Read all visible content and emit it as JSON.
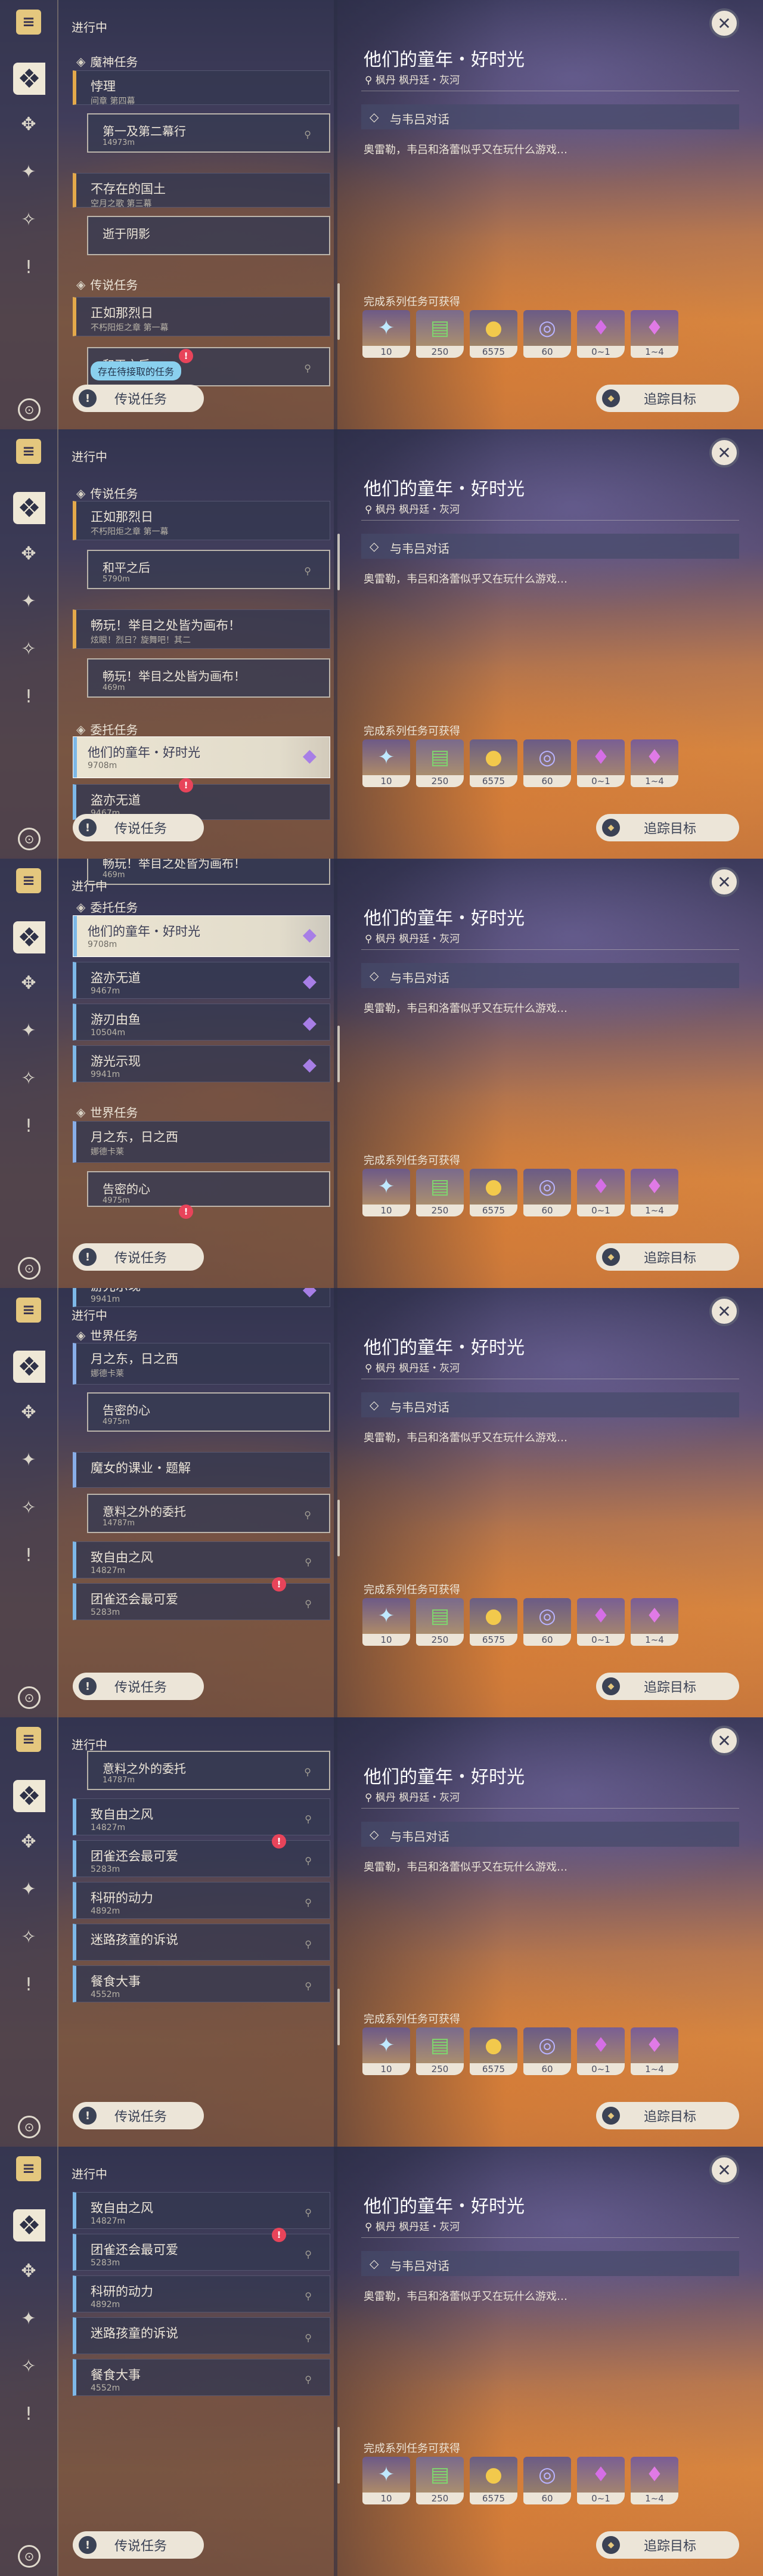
{
  "ui": {
    "in_progress": "进行中",
    "bottom_button": "传说任务",
    "tooltip": "存在待接取的任务",
    "track_button": "追踪目标"
  },
  "detail": {
    "title": "他们的童年・好时光",
    "location": "枫丹 枫丹廷・灰河",
    "step": "与韦吕对话",
    "description": "奥雷勒，韦吕和洛蕾似乎又在玩什么游戏…",
    "rewards_header": "完成系列任务可获得",
    "rewards": [
      {
        "icon": "primogem-icon",
        "count": "10"
      },
      {
        "icon": "hero-wit-icon",
        "count": "250"
      },
      {
        "icon": "mora-icon",
        "count": "6575"
      },
      {
        "icon": "adventure-exp-icon",
        "count": "60"
      },
      {
        "icon": "crystal-icon",
        "count": "0~1"
      },
      {
        "icon": "crystal-cluster-icon",
        "count": "1~4"
      }
    ]
  },
  "rail": {
    "top_icon": "quest-book-icon",
    "items": [
      "all-quests-icon",
      "archon-quest-icon",
      "world-quest-icon",
      "commission-icon",
      "event-icon"
    ],
    "bottom_icon": "navigation-icon"
  },
  "categories": {
    "archon": "魔神任务",
    "legend": "传说任务",
    "commission": "委托任务",
    "world": "世界任务"
  },
  "quests": {
    "q_dinglie": {
      "title": "悖理",
      "sub": "间章 第四幕"
    },
    "q_first_act": {
      "title": "第一及第二幕行",
      "sub": "14973m"
    },
    "q_nonexist": {
      "title": "不存在的国土",
      "sub": "空月之歌 第三幕"
    },
    "q_shadow": {
      "title": "逝于阴影",
      "sub": ""
    },
    "q_zhengru": {
      "title": "正如那烈日",
      "sub": "不朽阳炬之章 第一幕"
    },
    "q_peace": {
      "title": "和平之后",
      "sub": "5790m"
    },
    "q_play": {
      "title": "畅玩！举目之处皆为画布！",
      "sub": "炫眼！烈日？旋舞吧！其二"
    },
    "q_play_sub": {
      "title": "畅玩！举目之处皆为画布！",
      "sub": "469m"
    },
    "q_childhood": {
      "title": "他们的童年・好时光",
      "sub": "9708m"
    },
    "q_guidao": {
      "title": "盗亦无道",
      "sub": "9467m"
    },
    "q_youren": {
      "title": "游刃由鱼",
      "sub": "10504m"
    },
    "q_youguang": {
      "title": "游光示现",
      "sub": "9941m"
    },
    "q_moon": {
      "title": "月之东，日之西",
      "sub": "娜德卡莱"
    },
    "q_confess": {
      "title": "告密的心",
      "sub": "4975m"
    },
    "q_witch": {
      "title": "魔女的课业・题解",
      "sub": ""
    },
    "q_unexpected": {
      "title": "意料之外的委托",
      "sub": "14787m"
    },
    "q_wind": {
      "title": "致自由之风",
      "sub": "14827m"
    },
    "q_cute": {
      "title": "团雀还会最可爱",
      "sub": "5283m"
    },
    "q_research": {
      "title": "科研的动力",
      "sub": "4892m"
    },
    "q_lost": {
      "title": "迷路孩童的诉说",
      "sub": ""
    },
    "q_feast": {
      "title": "餐食大事",
      "sub": "4552m"
    }
  }
}
